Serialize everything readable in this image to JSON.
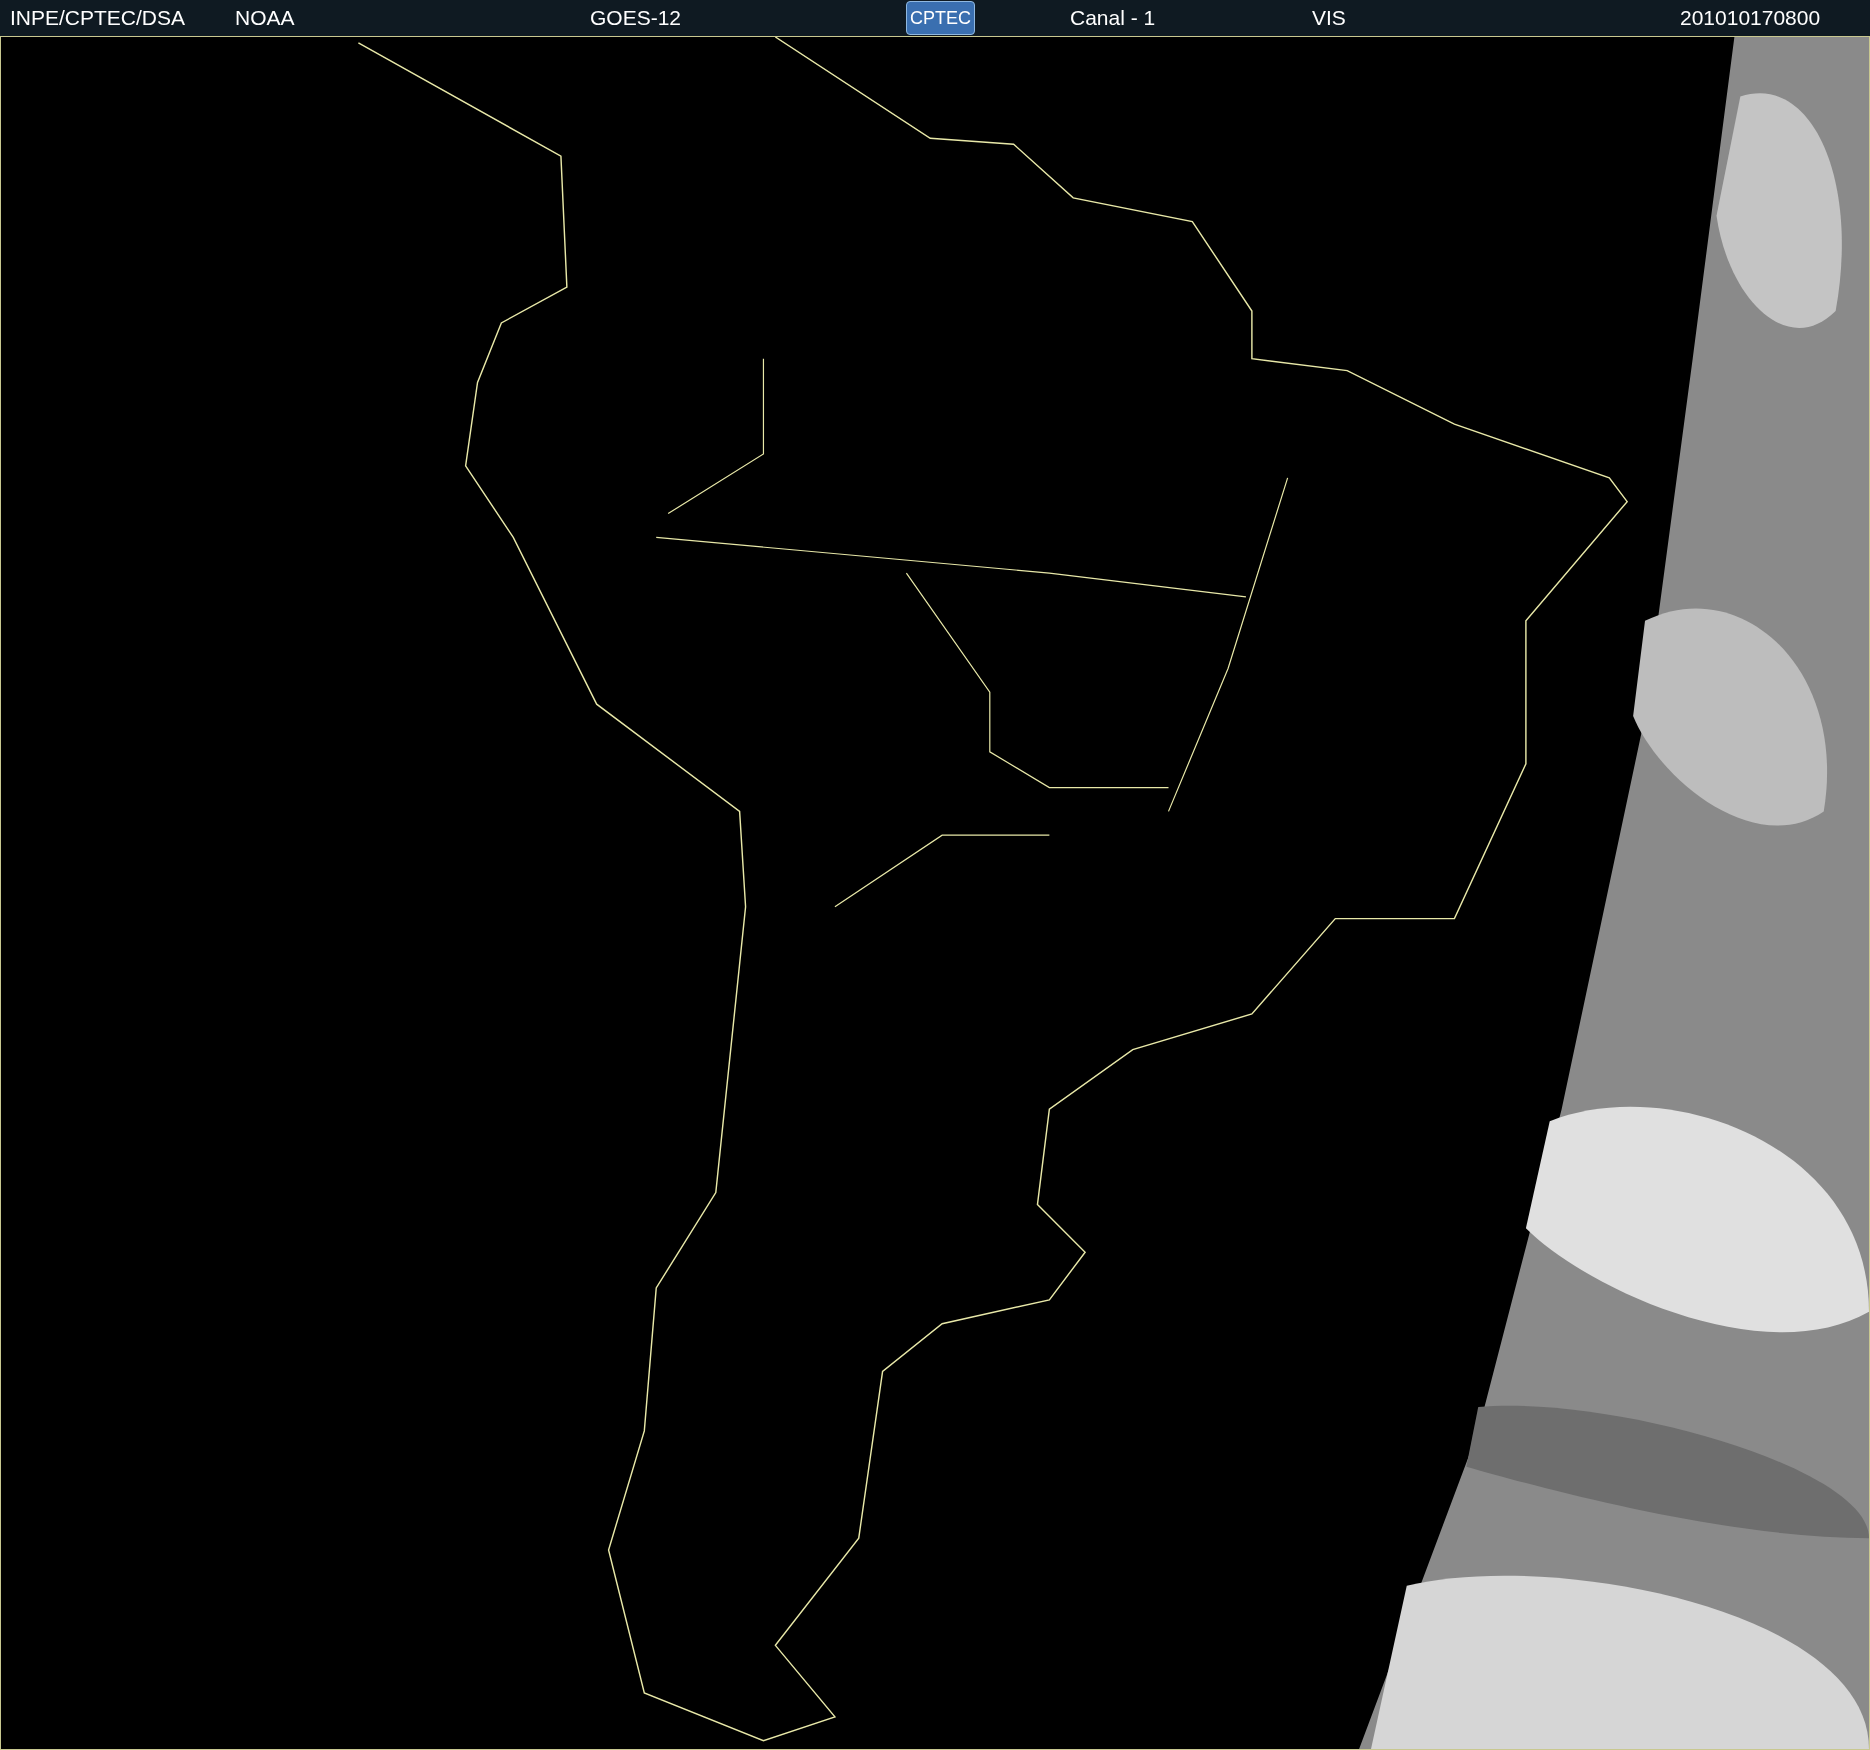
{
  "header": {
    "items": [
      {
        "kind": "text",
        "text": "INPE/CPTEC/DSA"
      },
      {
        "kind": "text",
        "text": "NOAA"
      },
      {
        "kind": "text",
        "text": "GOES-12"
      },
      {
        "kind": "logo",
        "text": "CPTEC"
      },
      {
        "kind": "text",
        "text": "Canal - 1"
      },
      {
        "kind": "text",
        "text": "VIS"
      },
      {
        "kind": "text",
        "text": "201010170800"
      }
    ]
  }
}
